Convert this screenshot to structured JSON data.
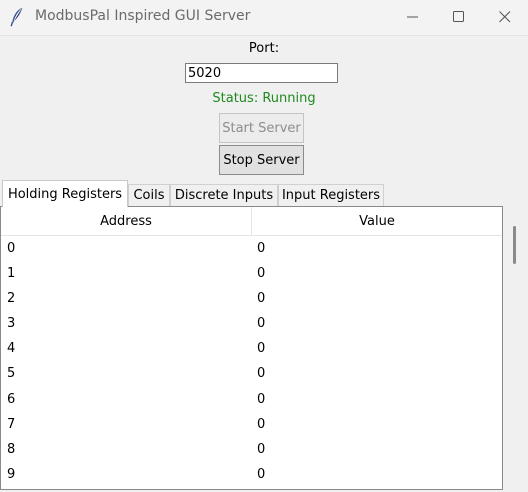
{
  "window": {
    "title": "ModbusPal Inspired GUI Server",
    "icon": "feather-icon"
  },
  "controls": {
    "port_label": "Port:",
    "port_value": "5020",
    "status": "Status: Running",
    "start_label": "Start Server",
    "stop_label": "Stop Server"
  },
  "tabs": [
    {
      "label": "Holding Registers",
      "active": true
    },
    {
      "label": "Coils",
      "active": false
    },
    {
      "label": "Discrete Inputs",
      "active": false
    },
    {
      "label": "Input Registers",
      "active": false
    }
  ],
  "table": {
    "columns": [
      "Address",
      "Value"
    ],
    "rows": [
      [
        "0",
        "0"
      ],
      [
        "1",
        "0"
      ],
      [
        "2",
        "0"
      ],
      [
        "3",
        "0"
      ],
      [
        "4",
        "0"
      ],
      [
        "5",
        "0"
      ],
      [
        "6",
        "0"
      ],
      [
        "7",
        "0"
      ],
      [
        "8",
        "0"
      ],
      [
        "9",
        "0"
      ]
    ]
  },
  "colors": {
    "status": "#1e8a1e",
    "background": "#f0f0f0"
  }
}
